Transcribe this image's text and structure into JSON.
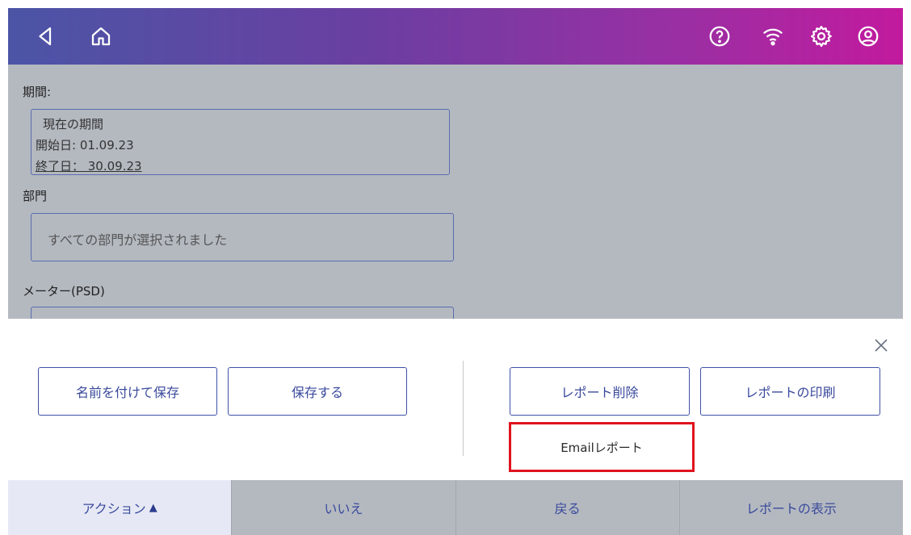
{
  "topbar": {
    "icons": [
      "back-icon",
      "home-icon",
      "help-icon",
      "wifi-icon",
      "settings-icon",
      "account-icon"
    ]
  },
  "form": {
    "period_label": "期間:",
    "period_lines": [
      "現在の期間",
      "開始日: 01.09.23",
      "終了日： 30.09.23"
    ],
    "department_label": "部門",
    "department_placeholder": "すべての部門が選択されました",
    "meter_label": "メーター(PSD)"
  },
  "actions": {
    "save_as": "名前を付けて保存",
    "save": "保存する",
    "delete_report": "レポート削除",
    "print_report": "レポートの印刷",
    "email_report": "Emailレポート"
  },
  "bottom_tabs": [
    {
      "label": "アクション",
      "caret": "▲",
      "active": true
    },
    {
      "label": "いいえ"
    },
    {
      "label": "戻る"
    },
    {
      "label": "レポートの表示"
    }
  ],
  "colors": {
    "accent": "#3f51a6",
    "highlight": "#e0141e",
    "gradient_start": "#4b55a6",
    "gradient_end": "#c21a9e"
  }
}
